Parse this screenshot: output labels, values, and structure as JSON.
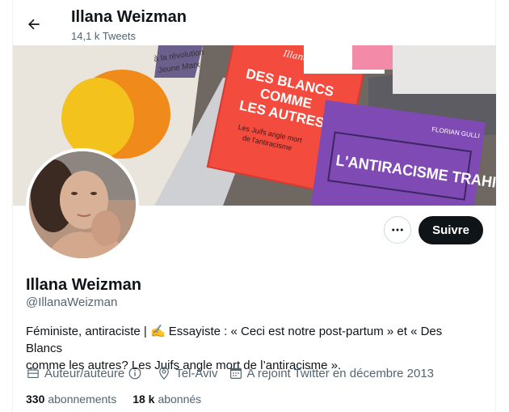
{
  "header": {
    "title": "Illana Weizman",
    "subtitle": "14,1 k Tweets"
  },
  "banner": {
    "book1_line1": "DES BLANCS",
    "book1_line2": "COMME",
    "book1_line3": "LES AUTRES ?",
    "book1_subtitle1": "Les Juifs angle mort",
    "book1_subtitle2": "de l'antiracisme",
    "book1_author": "Illana Weizman",
    "book2_author": "FLORIAN GULLI",
    "book2_title": "L'ANTIRACISME TRAHI",
    "book3_text1": "à la révolution",
    "book3_text2": "Jeune Marx"
  },
  "actions": {
    "follow_label": "Suivre"
  },
  "profile": {
    "name": "Illana Weizman",
    "handle": "@IllanaWeizman",
    "bio_line1": "Féministe, antiraciste | ✍️ Essayiste : « Ceci est notre post-partum » et « Des Blancs",
    "bio_line2": "comme les autres? Les Juifs angle mort de l’antiracisme ».",
    "category": "Auteur/auteure",
    "location": "Tel-Aviv",
    "joined": "A rejoint Twitter en décembre 2013"
  },
  "stats": {
    "following_count": "330",
    "following_label": "abonnements",
    "followers_count": "18 k",
    "followers_label": "abonnés"
  },
  "colors": {
    "accent_button": "#0f1419",
    "secondary_text": "#536471",
    "border": "#cfd9de"
  }
}
